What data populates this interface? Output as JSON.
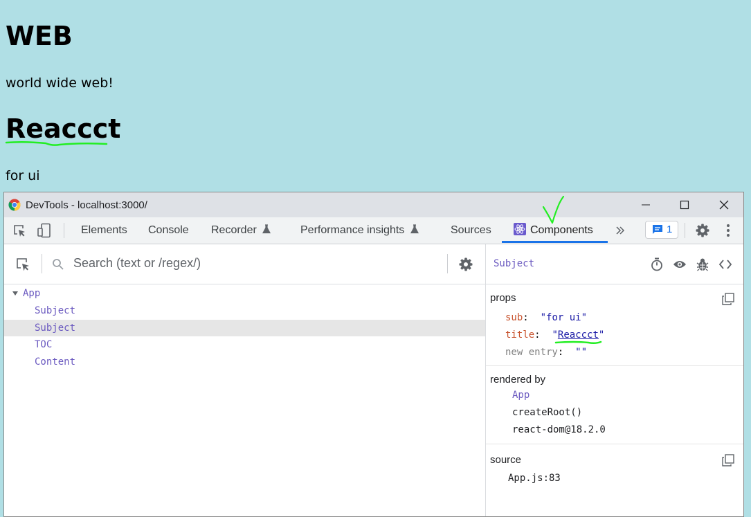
{
  "page": {
    "heading_web": "WEB",
    "text_web": "world wide web!",
    "heading_react": "Reaccct",
    "text_react": "for ui"
  },
  "devtools": {
    "window_title": "DevTools - localhost:3000/",
    "tabs": [
      {
        "label": "Elements"
      },
      {
        "label": "Console"
      },
      {
        "label": "Recorder"
      },
      {
        "label": "Performance insights"
      },
      {
        "label": "Sources"
      },
      {
        "label": "Components"
      }
    ],
    "active_tab": "Components",
    "issues_count": "1",
    "search": {
      "placeholder": "Search (text or /regex/)"
    },
    "tree": [
      {
        "label": "App",
        "expanded": true
      },
      {
        "label": "Subject"
      },
      {
        "label": "Subject",
        "selected": true
      },
      {
        "label": "TOC"
      },
      {
        "label": "Content"
      }
    ],
    "inspector": {
      "component_name": "Subject",
      "props_title": "props",
      "props": [
        {
          "key": "sub",
          "value": "\"for ui\""
        },
        {
          "key": "title",
          "value": "Reaccct"
        },
        {
          "key": "new entry",
          "value": "\"\""
        }
      ],
      "rendered_by_title": "rendered by",
      "rendered_by": [
        "App",
        "createRoot()",
        "react-dom@18.2.0"
      ],
      "source_title": "source",
      "source": "App.js:83"
    }
  },
  "colors": {
    "page_bg": "#b0dfe5",
    "accent": "#1a73e8",
    "component_name": "#6b5ac0",
    "prop_key": "#c8532e",
    "string_value": "#1a1aa6",
    "annotation": "#22ee22"
  }
}
